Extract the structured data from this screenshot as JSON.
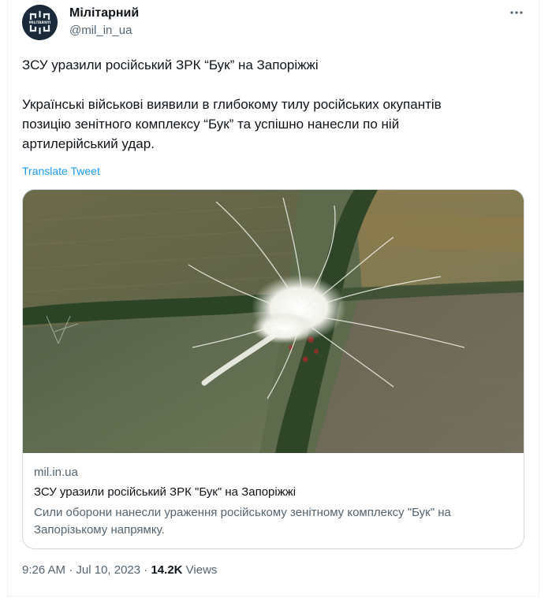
{
  "author": {
    "name": "Мілітарний",
    "handle": "@mil_in_ua",
    "avatar_text": "MILITARNYI"
  },
  "tweet": {
    "headline": "ЗСУ уразили російський ЗРК “Бук” на Запоріжжі",
    "body_line1": "Українські військові виявили в глибокому тилу російських окупантів",
    "body_line2": "позицію зенітного комплексу “Бук” та успішно нанесли по ній",
    "body_line3": "артилерійський удар.",
    "translate_label": "Translate Tweet"
  },
  "card": {
    "domain": "mil.in.ua",
    "title": "ЗСУ уразили російський ЗРК \"Бук\" на Запоріжжі",
    "description_line1": "Сили оборони нанесли ураження російському зенітному комплексу \"Бук\" на",
    "description_line2": "Запорізькому напрямку."
  },
  "meta": {
    "time": "9:26 AM",
    "dot1": " · ",
    "date": "Jul 10, 2023",
    "dot2": " · ",
    "views_count": "14.2K",
    "views_label": " Views"
  },
  "icons": {
    "more": "more-horizontal-icon",
    "avatar_logo": "militarnyi-logo"
  },
  "colors": {
    "link": "#1d9bf0",
    "secondary_text": "#536471",
    "primary_text": "#0f1419",
    "border": "#cfd9de"
  }
}
